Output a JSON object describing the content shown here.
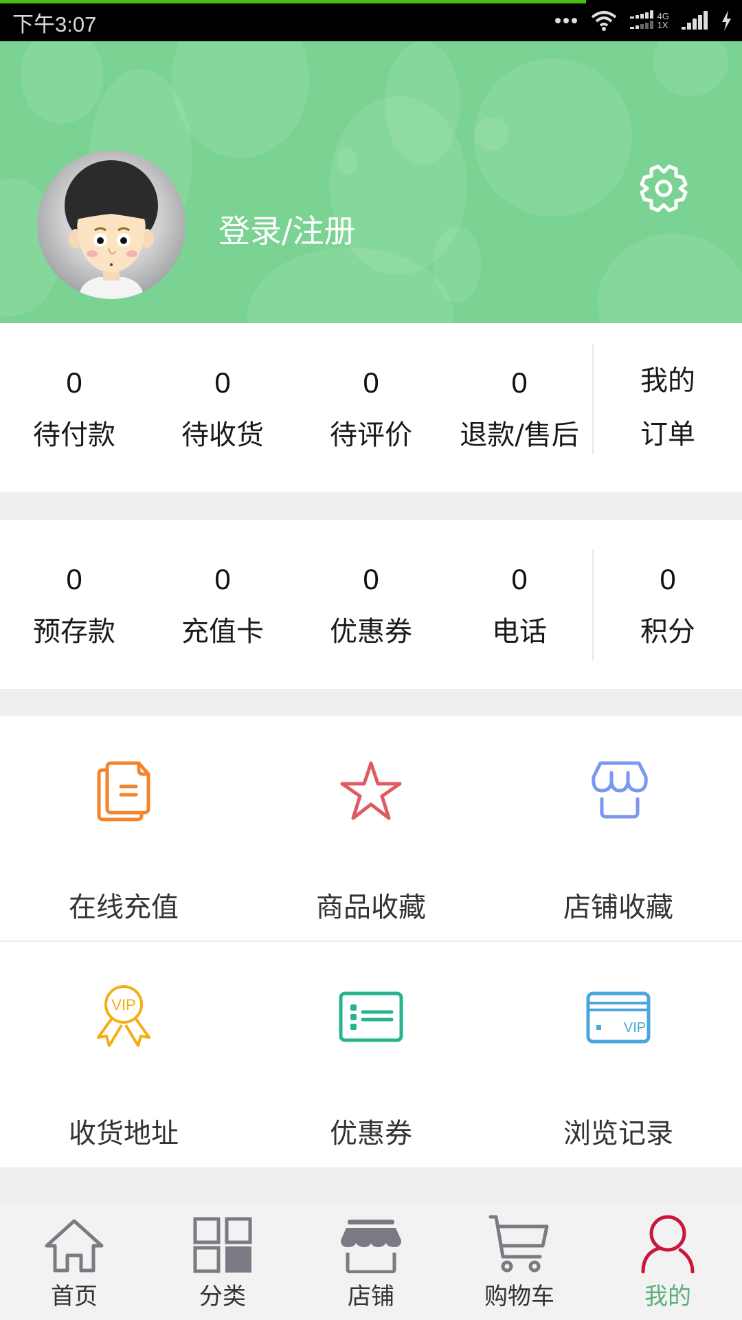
{
  "status_bar": {
    "time": "下午3:07",
    "network_top": "4G",
    "network_bottom": "1X",
    "page_load_progress": 0.79,
    "icons": [
      "more-dots-icon",
      "wifi-icon",
      "dual-signal-icon",
      "signal-icon",
      "charging-icon"
    ]
  },
  "header": {
    "login_label": "登录/注册",
    "settings_icon": "gear-icon",
    "avatar_icon": "cartoon-boy-avatar",
    "background_color": "#7bd393"
  },
  "orders": {
    "items": [
      {
        "count": "0",
        "label": "待付款"
      },
      {
        "count": "0",
        "label": "待收货"
      },
      {
        "count": "0",
        "label": "待评价"
      },
      {
        "count": "0",
        "label": "退款/售后"
      }
    ],
    "my_orders_line1": "我的",
    "my_orders_line2": "订单"
  },
  "assets": {
    "items": [
      {
        "count": "0",
        "label": "预存款"
      },
      {
        "count": "0",
        "label": "充值卡"
      },
      {
        "count": "0",
        "label": "优惠券"
      },
      {
        "count": "0",
        "label": "电话"
      },
      {
        "count": "0",
        "label": "积分"
      }
    ]
  },
  "services": {
    "rows": [
      [
        {
          "label": "在线充值",
          "icon": "documents-icon",
          "color": "#f5832a"
        },
        {
          "label": "商品收藏",
          "icon": "star-icon",
          "color": "#e05a62"
        },
        {
          "label": "店铺收藏",
          "icon": "store-icon",
          "color": "#7b97ee"
        }
      ],
      [
        {
          "label": "收货地址",
          "icon": "vip-medal-icon",
          "color": "#f6ad12"
        },
        {
          "label": "优惠券",
          "icon": "list-card-icon",
          "color": "#26b48f"
        },
        {
          "label": "浏览记录",
          "icon": "vip-card-icon",
          "color": "#4aa6dc"
        }
      ]
    ]
  },
  "bottom_nav": {
    "items": [
      {
        "label": "首页",
        "icon": "home-icon"
      },
      {
        "label": "分类",
        "icon": "grid-icon"
      },
      {
        "label": "店铺",
        "icon": "store-icon"
      },
      {
        "label": "购物车",
        "icon": "cart-icon"
      },
      {
        "label": "我的",
        "icon": "user-icon"
      }
    ],
    "active_index": 4,
    "icon_color": "#7a7a82",
    "active_icon_color": "#c8173a",
    "active_label_color": "#5aad7c"
  }
}
